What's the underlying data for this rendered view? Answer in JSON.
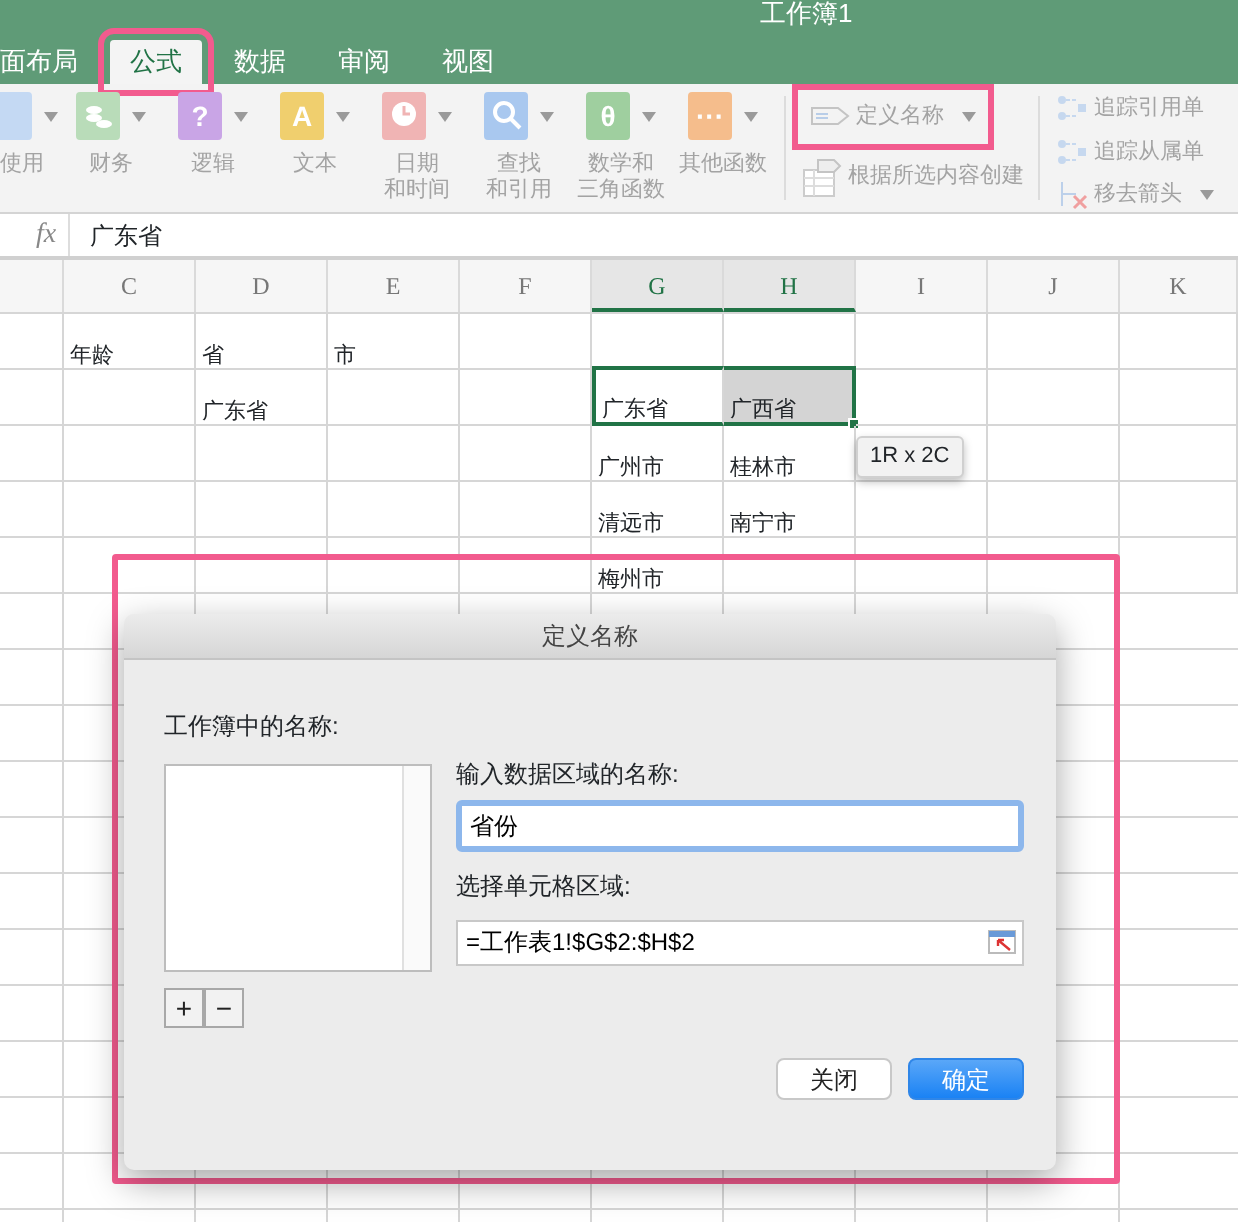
{
  "window": {
    "title": "工作簿1"
  },
  "ribbon_tabs": [
    {
      "label": "面布局",
      "selected": false,
      "highlighted": false
    },
    {
      "label": "公式",
      "selected": true,
      "highlighted": true
    },
    {
      "label": "数据",
      "selected": false,
      "highlighted": false
    },
    {
      "label": "审阅",
      "selected": false,
      "highlighted": false
    },
    {
      "label": "视图",
      "selected": false,
      "highlighted": false
    }
  ],
  "function_buttons": [
    {
      "label_lines": [
        "使用"
      ],
      "kind": "plain",
      "color": "#c4d9f3"
    },
    {
      "label_lines": [
        "财务"
      ],
      "kind": "coins",
      "color": "#b9dcb9"
    },
    {
      "label_lines": [
        "逻辑"
      ],
      "kind": "glyph",
      "glyph": "?",
      "color": "#c9a5e6"
    },
    {
      "label_lines": [
        "文本"
      ],
      "kind": "glyph",
      "glyph": "A",
      "color": "#f0cf6e"
    },
    {
      "label_lines": [
        "日期",
        "和时间"
      ],
      "kind": "clock",
      "color": "#f0b4b4"
    },
    {
      "label_lines": [
        "查找",
        "和引用"
      ],
      "kind": "magnifier",
      "color": "#a9c8ef"
    },
    {
      "label_lines": [
        "数学和",
        "三角函数"
      ],
      "kind": "glyph",
      "glyph": "θ",
      "color": "#9fcf9f"
    },
    {
      "label_lines": [
        "其他函数"
      ],
      "kind": "glyph",
      "glyph": "···",
      "color": "#f5bd8c"
    }
  ],
  "names_group": [
    {
      "label": "定义名称",
      "kind": "define",
      "dropdown": true,
      "highlighted": true
    },
    {
      "label": "根据所选内容创建",
      "kind": "create",
      "dropdown": false
    }
  ],
  "audit_group": [
    {
      "label": "追踪引用单",
      "kind": "precedents"
    },
    {
      "label": "追踪从属单",
      "kind": "dependents"
    },
    {
      "label": "移去箭头",
      "kind": "remove",
      "dropdown": true
    }
  ],
  "formula_bar": {
    "fx_label": "fx",
    "content": "广东省"
  },
  "sheet": {
    "columns": [
      {
        "selected": false
      },
      {
        "label": "C",
        "selected": false
      },
      {
        "label": "D",
        "selected": false
      },
      {
        "label": "E",
        "selected": false
      },
      {
        "label": "F",
        "selected": false
      },
      {
        "label": "G",
        "selected": true
      },
      {
        "label": "H",
        "selected": true
      },
      {
        "label": "I",
        "selected": false
      },
      {
        "label": "J",
        "selected": false
      },
      {
        "label": "K",
        "selected": false
      }
    ],
    "rows": [
      {
        "cells": [
          {
            "selected": false
          },
          {
            "text": "年龄",
            "selected": false
          },
          {
            "text": "省",
            "selected": false
          },
          {
            "text": "市",
            "selected": false
          },
          {
            "selected": false
          },
          {
            "selected": false
          },
          {
            "selected": false
          },
          {
            "selected": false
          },
          {
            "selected": false
          },
          {
            "selected": false
          }
        ]
      },
      {
        "cells": [
          {
            "selected": false
          },
          {
            "selected": false
          },
          {
            "text": "广东省",
            "selected": false
          },
          {
            "selected": false
          },
          {
            "selected": false
          },
          {
            "text": "广东省",
            "selected": true,
            "active": true
          },
          {
            "text": "广西省",
            "selected": true,
            "active": false
          },
          {
            "selected": false
          },
          {
            "selected": false
          },
          {
            "selected": false
          }
        ]
      },
      {
        "cells": [
          {
            "selected": false
          },
          {
            "selected": false
          },
          {
            "selected": false
          },
          {
            "selected": false
          },
          {
            "selected": false
          },
          {
            "text": "广州市",
            "selected": false
          },
          {
            "text": "桂林市",
            "selected": false
          },
          {
            "selected": false
          },
          {
            "selected": false
          },
          {
            "selected": false
          }
        ]
      },
      {
        "cells": [
          {
            "selected": false
          },
          {
            "selected": false
          },
          {
            "selected": false
          },
          {
            "selected": false
          },
          {
            "selected": false
          },
          {
            "text": "清远市",
            "selected": false
          },
          {
            "text": "南宁市",
            "selected": false
          },
          {
            "selected": false
          },
          {
            "selected": false
          },
          {
            "selected": false
          }
        ]
      },
      {
        "cells": [
          {
            "selected": false
          },
          {
            "selected": false
          },
          {
            "selected": false
          },
          {
            "selected": false
          },
          {
            "selected": false
          },
          {
            "text": "梅州市",
            "selected": false
          },
          {
            "selected": false
          },
          {
            "selected": false
          },
          {
            "selected": false
          },
          {
            "selected": false
          }
        ]
      }
    ],
    "size_tooltip": "1R x 2C"
  },
  "dialog": {
    "title": "定义名称",
    "highlighted": true,
    "list_label": "工作簿中的名称:",
    "name_label": "输入数据区域的名称:",
    "name_value": "省份",
    "range_label": "选择单元格区域:",
    "range_value": "=工作表1!$G$2:$H$2",
    "add_button": "+",
    "remove_button": "−",
    "buttons": [
      {
        "label": "关闭",
        "default": false
      },
      {
        "label": "确定",
        "default": true
      }
    ]
  }
}
